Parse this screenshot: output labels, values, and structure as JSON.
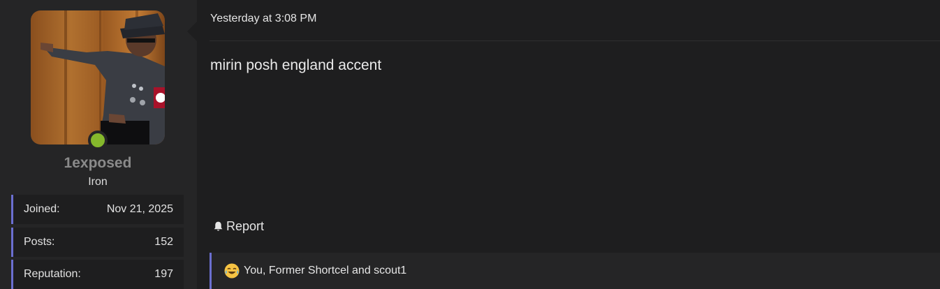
{
  "user": {
    "username": "1exposed",
    "title": "Iron",
    "online": true,
    "avatar_icon": "user-avatar-image",
    "stats": [
      {
        "label": "Joined:",
        "value": "Nov 21, 2025"
      },
      {
        "label": "Posts:",
        "value": "152"
      },
      {
        "label": "Reputation:",
        "value": "197"
      }
    ]
  },
  "post": {
    "date": "Yesterday at 3:08 PM",
    "body": "mirin posh england accent",
    "report_label": "Report",
    "report_icon": "bell-icon"
  },
  "reactions": {
    "icon": "laughing-crying-emoji-icon",
    "text": "You, Former Shortcel and scout1"
  },
  "colors": {
    "accent": "#6b6fd0",
    "online": "#85b82c",
    "background": "#1e1e1f",
    "panel": "#252526"
  }
}
